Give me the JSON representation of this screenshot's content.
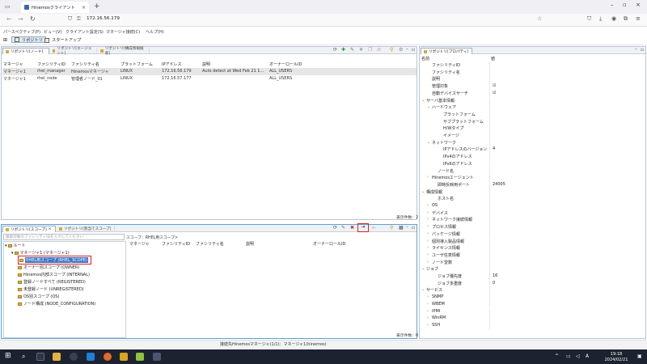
{
  "browser": {
    "tab_title": "Hinemosクライアント",
    "url": "172.16.56.179"
  },
  "app": {
    "menu": [
      "パースペクティブ(P)",
      "ビュー(V)",
      "クライアント設定(S)",
      "マネージャ接続(C)",
      "ヘルプ(H)"
    ],
    "perspectives": [
      "リポジトリ",
      "スタートアップ"
    ]
  },
  "node_view": {
    "tabs": [
      "リポジトリ[ノード]",
      "リポジトリ[エージェント]",
      "リポジトリ[構成情報検索]"
    ],
    "columns": [
      "マネージャ",
      "ファシリティID",
      "ファシリティ名",
      "プラットフォーム",
      "IPアドレス",
      "説明",
      "オーナーロールID"
    ],
    "rows": [
      [
        "マネージャ1",
        "rhel_manager",
        "Hinemosマネージャ",
        "LINUX",
        "172.16.56.179",
        "Auto detect at Wed Feb 21 1...",
        "ALL_USERS"
      ],
      [
        "マネージャ1",
        "rhel_node",
        "管理者ノード_01",
        "LINUX",
        "172.16.57.177",
        "",
        "ALL_USERS"
      ]
    ],
    "count": "表示件数：2"
  },
  "scope_view": {
    "tabs": [
      "リポジトリ[スコープ]",
      "リポジトリ[割当てスコープ]"
    ],
    "search_placeholder": "検索対象のファシリティIDを入力してください",
    "scope_label": "スコープ：RHEL用スコープ>",
    "columns": [
      "マネージャ",
      "ファシリティID",
      "ファシリティ名",
      "説明",
      "オーナーロールID"
    ],
    "tree": [
      "ルート",
      "マネージャ1 (マネージャ1)",
      "RHEL用スコープ (RHEL_SCOPE)",
      "オーナー別スコープ (OWNER)",
      "Hinemos内部スコープ (INTERNAL)",
      "登録ノードすべて (REGISTERED)",
      "未登録ノード (UNREGISTERED)",
      "OS別スコープ (OS)",
      "ノード構成 (NODE_CONFIGURATION)"
    ],
    "count": "表示件数：0"
  },
  "property_view": {
    "tab": "リポジトリ[プロパティ]",
    "headers": [
      "名前",
      "値"
    ],
    "rows": [
      {
        "name": "ファシリティID",
        "value": "",
        "indent": 1
      },
      {
        "name": "ファシリティ名",
        "value": "",
        "indent": 1
      },
      {
        "name": "説明",
        "value": "",
        "indent": 1
      },
      {
        "name": "管理対象",
        "value": "☑",
        "indent": 1
      },
      {
        "name": "自動デバイスサーチ",
        "value": "☑",
        "indent": 1
      },
      {
        "name": "サーバ基本情報",
        "value": "",
        "indent": 0,
        "toggle": "⌄"
      },
      {
        "name": "ハードウェア",
        "value": "",
        "indent": 1,
        "toggle": "⌄"
      },
      {
        "name": "プラットフォーム",
        "value": "",
        "indent": 3
      },
      {
        "name": "サブプラットフォーム",
        "value": "",
        "indent": 3
      },
      {
        "name": "H/Wタイプ",
        "value": "",
        "indent": 3
      },
      {
        "name": "イメージ",
        "value": "",
        "indent": 3
      },
      {
        "name": "ネットワーク",
        "value": "",
        "indent": 1,
        "toggle": "⌄"
      },
      {
        "name": "IPアドレスのバージョン",
        "value": "4",
        "indent": 3
      },
      {
        "name": "IPv4のアドレス",
        "value": "",
        "indent": 3
      },
      {
        "name": "IPv6のアドレス",
        "value": "",
        "indent": 3
      },
      {
        "name": "ノード名",
        "value": "",
        "indent": 2
      },
      {
        "name": "Hinemosエージェント",
        "value": "",
        "indent": 1,
        "toggle": "›"
      },
      {
        "name": "即時反映用ポート",
        "value": "24005",
        "indent": 2
      },
      {
        "name": "構成情報",
        "value": "",
        "indent": 0,
        "toggle": "⌄"
      },
      {
        "name": "ホスト名",
        "value": "",
        "indent": 2
      },
      {
        "name": "OS",
        "value": "",
        "indent": 1,
        "toggle": "›"
      },
      {
        "name": "デバイス",
        "value": "",
        "indent": 1,
        "toggle": "›"
      },
      {
        "name": "ネットワーク接続情報",
        "value": "",
        "indent": 1,
        "toggle": "›"
      },
      {
        "name": "プロセス情報",
        "value": "",
        "indent": 1,
        "toggle": "›"
      },
      {
        "name": "パッケージ情報",
        "value": "",
        "indent": 1,
        "toggle": "›"
      },
      {
        "name": "個別導入製品情報",
        "value": "",
        "indent": 1,
        "toggle": "›"
      },
      {
        "name": "ライセンス情報",
        "value": "",
        "indent": 1,
        "toggle": "›"
      },
      {
        "name": "ユーザ任意情報",
        "value": "",
        "indent": 1,
        "toggle": "›"
      },
      {
        "name": "ノード変数",
        "value": "",
        "indent": 1,
        "toggle": "›"
      },
      {
        "name": "ジョブ",
        "value": "",
        "indent": 0,
        "toggle": "⌄"
      },
      {
        "name": "ジョブ優先度",
        "value": "16",
        "indent": 2
      },
      {
        "name": "ジョブ多重度",
        "value": "0",
        "indent": 2
      },
      {
        "name": "サービス",
        "value": "",
        "indent": 0,
        "toggle": "⌄"
      },
      {
        "name": "SNMP",
        "value": "",
        "indent": 1,
        "toggle": "›"
      },
      {
        "name": "WBEM",
        "value": "",
        "indent": 1,
        "toggle": "›"
      },
      {
        "name": "IPMI",
        "value": "",
        "indent": 1,
        "toggle": "›"
      },
      {
        "name": "WinRM",
        "value": "",
        "indent": 1,
        "toggle": "›"
      },
      {
        "name": "SSH",
        "value": "",
        "indent": 1,
        "toggle": "›"
      }
    ]
  },
  "status_bar": "接続先Hinemosマネージャ(1/1)：マネージャ1(hinemos)",
  "taskbar": {
    "time": "19:18",
    "date": "2024/02/21"
  }
}
